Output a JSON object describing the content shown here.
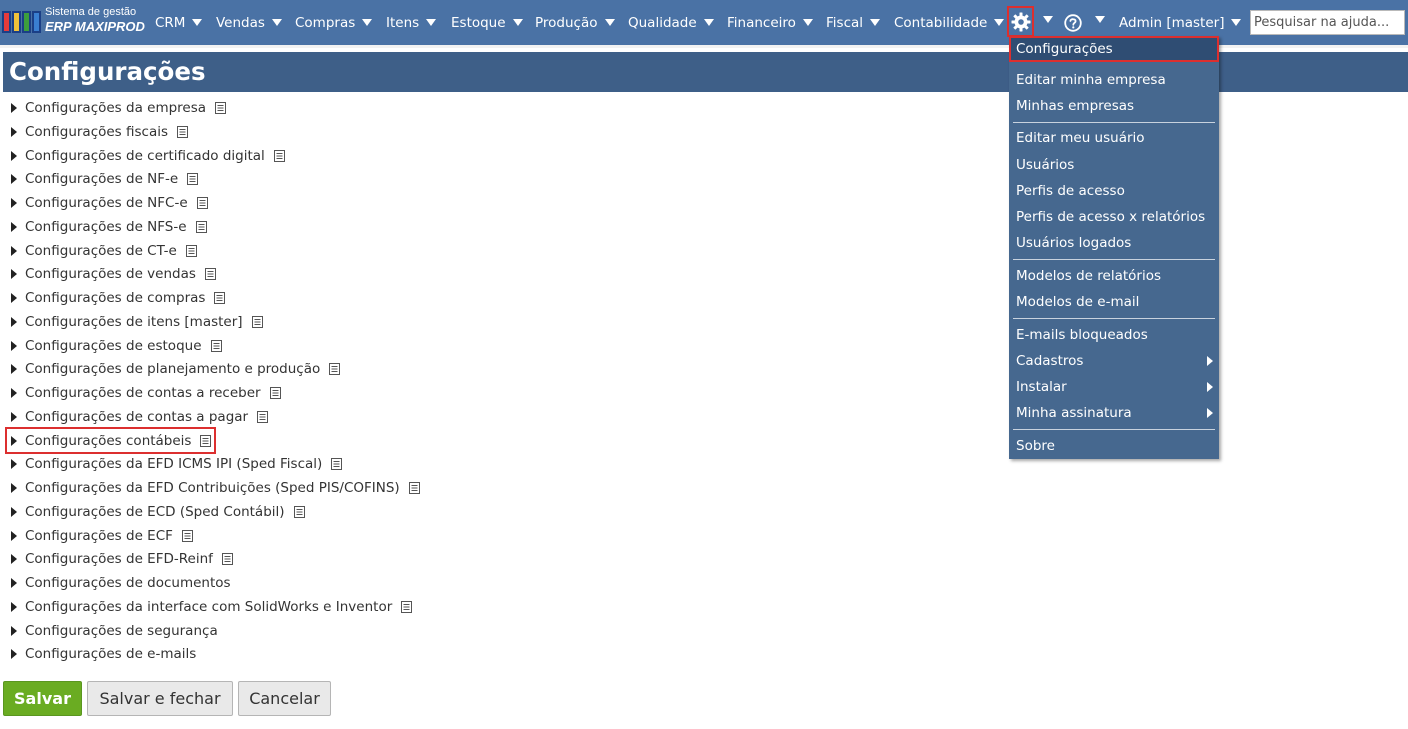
{
  "logo": {
    "line1": "Sistema de gestão",
    "line2": "ERP MAXIPROD"
  },
  "nav": {
    "items": [
      {
        "label": "CRM"
      },
      {
        "label": "Vendas"
      },
      {
        "label": "Compras"
      },
      {
        "label": "Itens"
      },
      {
        "label": "Estoque"
      },
      {
        "label": "Produção"
      },
      {
        "label": "Qualidade"
      },
      {
        "label": "Financeiro"
      },
      {
        "label": "Fiscal"
      },
      {
        "label": "Contabilidade"
      }
    ],
    "settings_icon": "gear-icon",
    "help_icon": "help-icon",
    "user_label": "Admin [master]"
  },
  "search": {
    "placeholder": "Pesquisar na ajuda..."
  },
  "page": {
    "title": "Configurações"
  },
  "settings": {
    "rows": [
      {
        "label": "Configurações da empresa",
        "has_doc": true
      },
      {
        "label": "Configurações fiscais",
        "has_doc": true
      },
      {
        "label": "Configurações de certificado digital",
        "has_doc": true
      },
      {
        "label": "Configurações de NF-e",
        "has_doc": true
      },
      {
        "label": "Configurações de NFC-e",
        "has_doc": true
      },
      {
        "label": "Configurações de NFS-e",
        "has_doc": true
      },
      {
        "label": "Configurações de CT-e",
        "has_doc": true
      },
      {
        "label": "Configurações de vendas",
        "has_doc": true
      },
      {
        "label": "Configurações de compras",
        "has_doc": true
      },
      {
        "label": "Configurações de itens [master]",
        "has_doc": true
      },
      {
        "label": "Configurações de estoque",
        "has_doc": true
      },
      {
        "label": "Configurações de planejamento e produção",
        "has_doc": true
      },
      {
        "label": "Configurações de contas a receber",
        "has_doc": true
      },
      {
        "label": "Configurações de contas a pagar",
        "has_doc": true
      },
      {
        "label": "Configurações contábeis",
        "has_doc": true,
        "highlighted": true
      },
      {
        "label": "Configurações da EFD ICMS IPI (Sped Fiscal)",
        "has_doc": true
      },
      {
        "label": "Configurações da EFD Contribuições (Sped PIS/COFINS)",
        "has_doc": true
      },
      {
        "label": "Configurações de ECD (Sped Contábil)",
        "has_doc": true
      },
      {
        "label": "Configurações de ECF",
        "has_doc": true
      },
      {
        "label": "Configurações de EFD-Reinf",
        "has_doc": true
      },
      {
        "label": "Configurações de documentos",
        "has_doc": false
      },
      {
        "label": "Configurações da interface com SolidWorks e Inventor",
        "has_doc": true
      },
      {
        "label": "Configurações de segurança",
        "has_doc": false
      },
      {
        "label": "Configurações de e-mails",
        "has_doc": false
      }
    ]
  },
  "buttons": {
    "save": "Salvar",
    "save_close": "Salvar e fechar",
    "cancel": "Cancelar"
  },
  "menu": {
    "items": [
      {
        "label": "Configurações",
        "active": true
      },
      {
        "label": "Editar minha empresa"
      },
      {
        "label": "Minhas empresas"
      },
      {
        "label": "Editar meu usuário"
      },
      {
        "label": "Usuários"
      },
      {
        "label": "Perfis de acesso"
      },
      {
        "label": "Perfis de acesso x relatórios"
      },
      {
        "label": "Usuários logados"
      },
      {
        "label": "Modelos de relatórios"
      },
      {
        "label": "Modelos de e-mail"
      },
      {
        "label": "E-mails bloqueados"
      },
      {
        "label": "Cadastros",
        "submenu": true
      },
      {
        "label": "Instalar",
        "submenu": true
      },
      {
        "label": "Minha assinatura",
        "submenu": true
      },
      {
        "label": "Sobre"
      }
    ]
  },
  "colors": {
    "topbar": "#4a72a5",
    "title_bar": "#3e5f88",
    "menu_bg": "#46688f",
    "highlight": "#dc2f2f",
    "save_button": "#6aac22"
  }
}
